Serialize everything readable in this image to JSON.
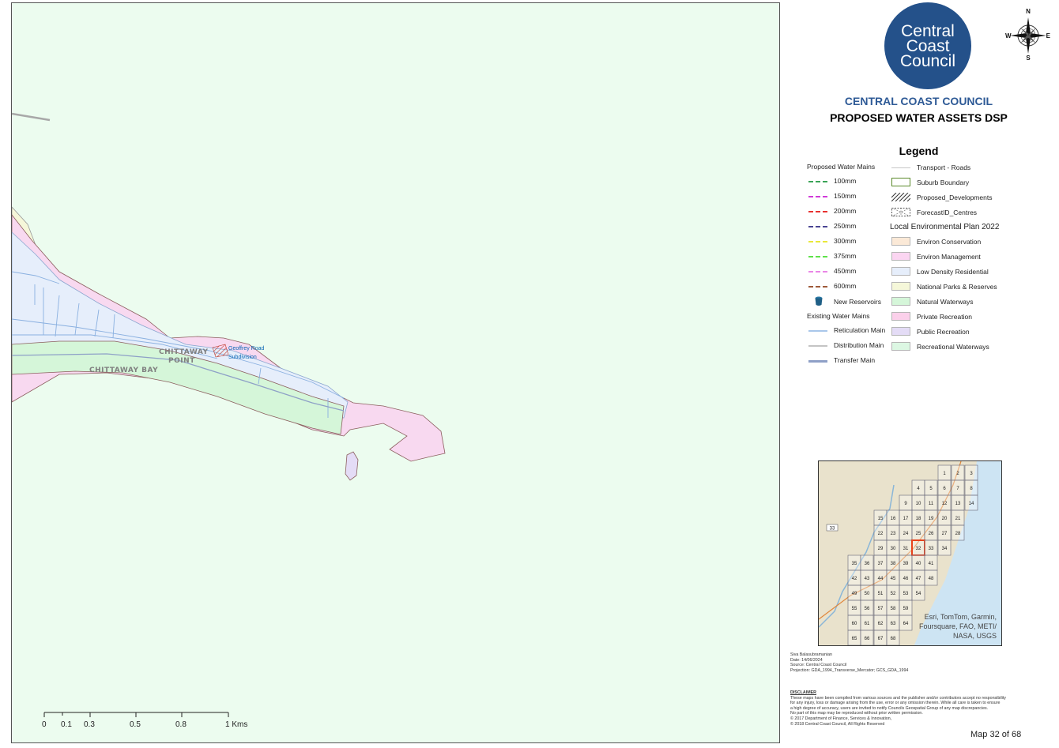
{
  "map": {
    "places": [
      {
        "name": "CHITTAWAY",
        "line2": "POINT"
      },
      {
        "name": "CHITTAWAY BAY"
      }
    ],
    "development_label": {
      "line1": "Geoffrey Road",
      "line2": "Subdivision"
    },
    "scale_bar": {
      "labels": [
        "0",
        "0.1",
        "0.3",
        "0.5",
        "0.8",
        "1 Kms"
      ]
    }
  },
  "panel": {
    "logo": {
      "line1": "Central",
      "line2": "Coast",
      "line3": "Council"
    },
    "compass": {
      "n": "N",
      "e": "E",
      "s": "S",
      "w": "W"
    },
    "org_title": "CENTRAL COAST COUNCIL",
    "map_title": "PROPOSED WATER ASSETS DSP",
    "legend": {
      "title": "Legend",
      "proposed_heading": "Proposed Water Mains",
      "proposed": [
        {
          "label": "100mm",
          "color": "#3aa356"
        },
        {
          "label": "150mm",
          "color": "#d13ad9"
        },
        {
          "label": "200mm",
          "color": "#e8312f"
        },
        {
          "label": "250mm",
          "color": "#4a4593"
        },
        {
          "label": "300mm",
          "color": "#e9e83a"
        },
        {
          "label": "375mm",
          "color": "#5fe24a"
        },
        {
          "label": "450mm",
          "color": "#ea86e6"
        },
        {
          "label": "600mm",
          "color": "#9e5a3a"
        }
      ],
      "reservoir_label": "New Reservoirs",
      "existing_heading": "Existing Water Mains",
      "existing": [
        {
          "label": "Reticulation Main",
          "color": "#a9c7ea"
        },
        {
          "label": "Distribution Main",
          "color": "#c4c4c4"
        },
        {
          "label": "Transfer Main",
          "color": "#8ea0c7"
        }
      ],
      "roads_label": "Transport - Roads",
      "suburb_label": "Suburb Boundary",
      "proposed_dev_label": "Proposed_Developments",
      "centres_label": "ForecastID_Centres",
      "lep_heading": "Local Environmental Plan 2022",
      "lep": [
        {
          "label": "Environ Conservation",
          "color": "#fbe9d7"
        },
        {
          "label": "Environ Management",
          "color": "#fbd5f1"
        },
        {
          "label": "Low Density Residential",
          "color": "#e6eefb"
        },
        {
          "label": "National Parks & Reserves",
          "color": "#f5f7d9"
        },
        {
          "label": "Natural Waterways",
          "color": "#d5f6d9"
        },
        {
          "label": "Private Recreation",
          "color": "#fbd0ea"
        },
        {
          "label": "Public Recreation",
          "color": "#e4dcf6"
        },
        {
          "label": "Recreational Waterways",
          "color": "#dcf7e3"
        }
      ]
    },
    "overview": {
      "road_label": "33",
      "tiles": [
        "1",
        "2",
        "3",
        "4",
        "5",
        "6",
        "7",
        "8",
        "9",
        "10",
        "11",
        "12",
        "13",
        "14",
        "15",
        "16",
        "17",
        "18",
        "19",
        "20",
        "21",
        "22",
        "23",
        "24",
        "25",
        "26",
        "27",
        "28",
        "29",
        "30",
        "31",
        "32",
        "33",
        "34",
        "35",
        "36",
        "37",
        "38",
        "39",
        "40",
        "41",
        "42",
        "43",
        "44",
        "45",
        "46",
        "47",
        "48",
        "49",
        "50",
        "51",
        "52",
        "53",
        "54",
        "55",
        "56",
        "57",
        "58",
        "59",
        "60",
        "61",
        "62",
        "63",
        "64",
        "65",
        "66",
        "67",
        "68"
      ],
      "current": "32",
      "attribution": [
        "Esri, TomTom, Garmin,",
        "Foursquare, FAO, METI/",
        "NASA, USGS"
      ]
    },
    "meta": [
      "Siva Balasubramanian",
      "Date: 14/06/2024",
      "Source: Central Coast Council",
      "Projection: GDA_1994_Transverse_Mercator; GCS_GDA_1994"
    ],
    "disclaimer": {
      "heading": "DISCLAIMER",
      "lines": [
        "These maps have been compiled from various sources and the publisher and/or contributors accept no responsibility",
        "for any injury, loss or damage arising from the use, error or any omission therein. While all care is taken to ensure",
        "a high degree of accuracy, users are invited to notify Councils Geospatial Group of any map discrepancies.",
        "No part of this map may be reproduced without prior written permission.",
        "© 2017 Department of Finance, Services & Innovation,",
        "© 2018 Central Coast Council, All Rights Reserved"
      ]
    },
    "map_number": "Map 32 of 68"
  }
}
